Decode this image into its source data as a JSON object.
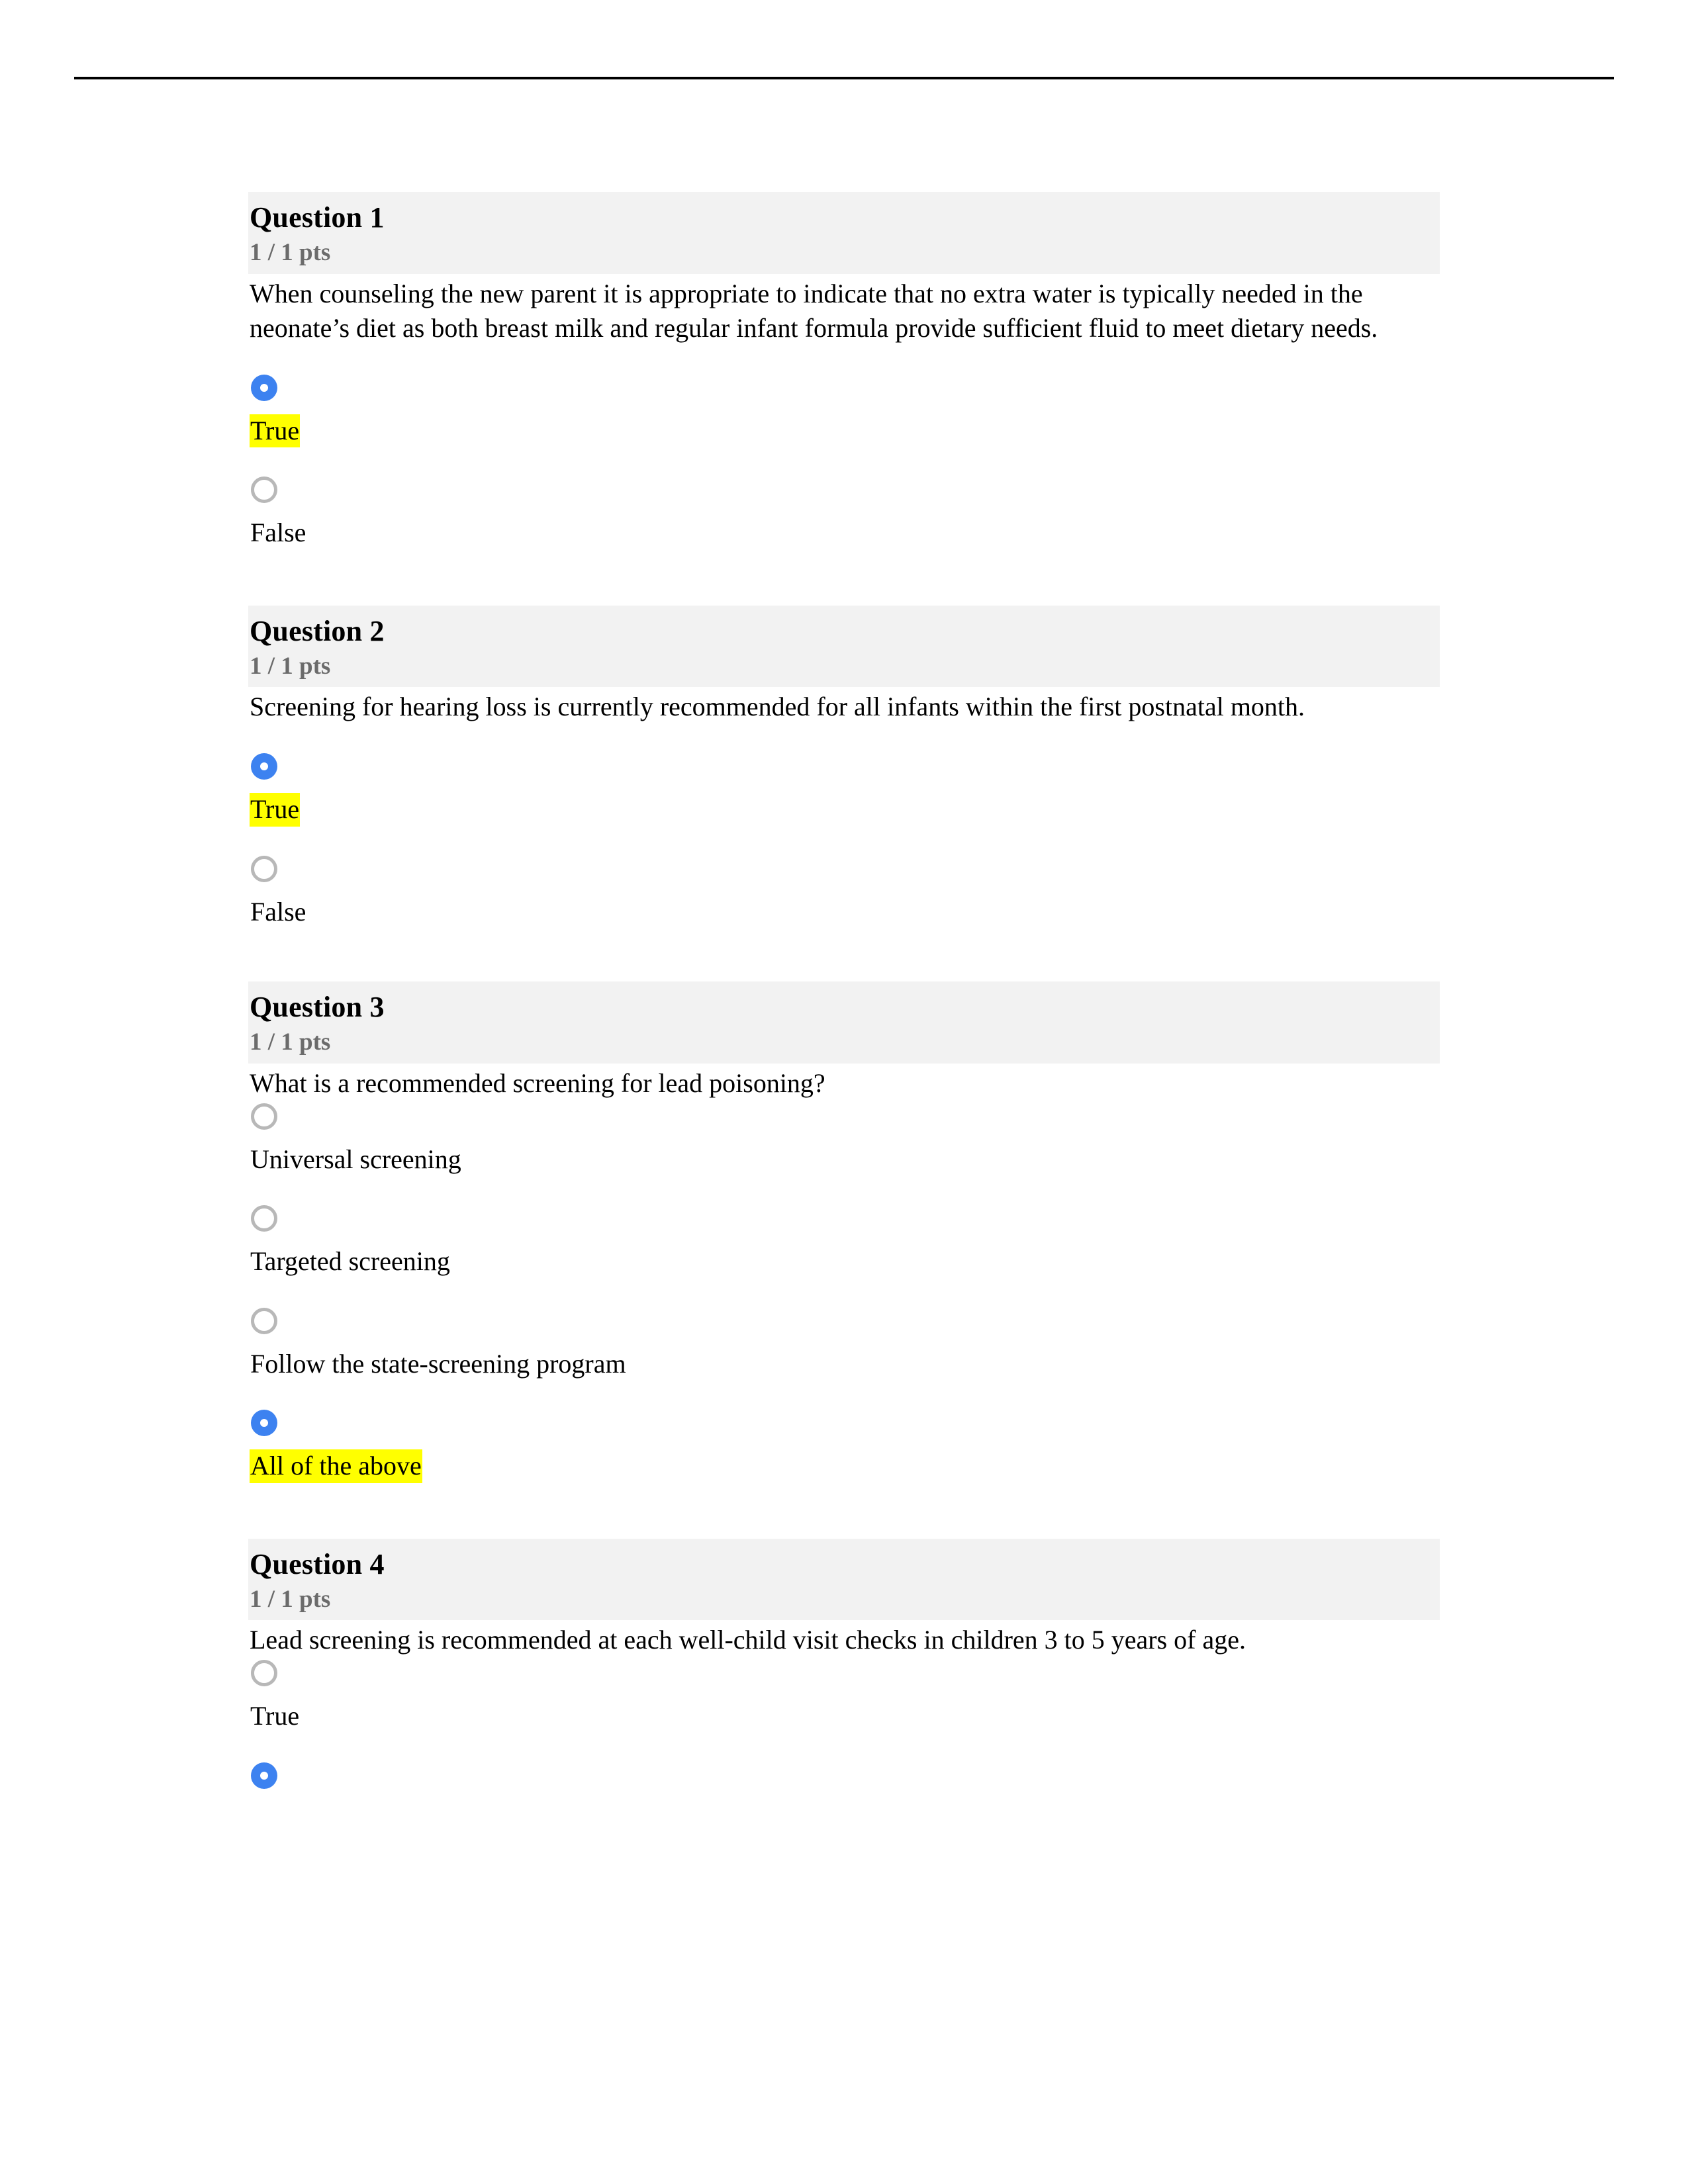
{
  "document": {
    "type": "quiz-results",
    "colors": {
      "header_background": "#f2f2f2",
      "selected_radio": "#3d82f0",
      "unselected_radio_border": "#b8b8b8",
      "highlight": "#ffff00",
      "points_text": "#6b6b6b",
      "rule": "#000000"
    }
  },
  "questions": [
    {
      "title": "Question 1",
      "points": "1 / 1 pts",
      "text": "When counseling the new parent it is appropriate to indicate that no extra water is typically needed in the neonate’s diet as both breast milk and regular infant formula provide sufficient fluid to meet dietary needs.",
      "layout": "spaced",
      "options": [
        {
          "label": "True",
          "selected": true,
          "highlighted": true
        },
        {
          "label": "False",
          "selected": false,
          "highlighted": false
        }
      ]
    },
    {
      "title": "Question 2",
      "points": "1 / 1 pts",
      "text": "Screening for hearing loss is currently recommended for all infants within the first postnatal month.",
      "layout": "spaced",
      "options": [
        {
          "label": "True",
          "selected": true,
          "highlighted": true
        },
        {
          "label": "False",
          "selected": false,
          "highlighted": false
        }
      ]
    },
    {
      "title": "Question 3",
      "points": "1 / 1 pts",
      "text": "What is a recommended screening for lead poisoning?",
      "layout": "tight",
      "options": [
        {
          "label": "Universal screening",
          "selected": false,
          "highlighted": false
        },
        {
          "label": "Targeted screening",
          "selected": false,
          "highlighted": false
        },
        {
          "label": "Follow the state-screening program",
          "selected": false,
          "highlighted": false
        },
        {
          "label": "All of the above",
          "selected": true,
          "highlighted": true
        }
      ]
    },
    {
      "title": "Question 4",
      "points": "1 / 1 pts",
      "text": "Lead screening is recommended at each well-child visit checks in children 3 to 5 years of age.",
      "layout": "tight",
      "options": [
        {
          "label": "True",
          "selected": false,
          "highlighted": false
        },
        {
          "label": "",
          "selected": true,
          "highlighted": false
        }
      ]
    }
  ]
}
